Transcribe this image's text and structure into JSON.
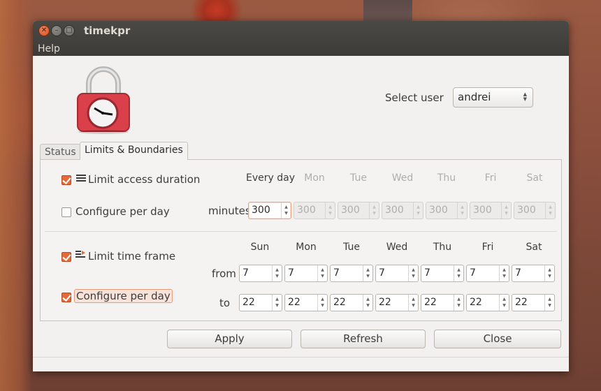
{
  "window": {
    "title": "timekpr"
  },
  "menu": {
    "help": "Help"
  },
  "user_select": {
    "label": "Select user",
    "value": "andrei"
  },
  "tabs": [
    {
      "label": "Status",
      "active": false
    },
    {
      "label": "Limits & Boundaries",
      "active": true
    }
  ],
  "duration": {
    "limit_label": "Limit access duration",
    "limit_checked": true,
    "per_day_label": "Configure per day",
    "per_day_checked": false,
    "minutes_label": "minutes",
    "headers": [
      "Every day",
      "Mon",
      "Tue",
      "Wed",
      "Thu",
      "Fri",
      "Sat"
    ],
    "values": [
      "300",
      "300",
      "300",
      "300",
      "300",
      "300",
      "300"
    ]
  },
  "timeframe": {
    "limit_label": "Limit time frame",
    "limit_checked": true,
    "per_day_label": "Configure per day",
    "per_day_checked": true,
    "from_label": "from",
    "to_label": "to",
    "days": [
      "Sun",
      "Mon",
      "Tue",
      "Wed",
      "Thu",
      "Fri",
      "Sat"
    ],
    "from": [
      "7",
      "7",
      "7",
      "7",
      "7",
      "7",
      "7"
    ],
    "to": [
      "22",
      "22",
      "22",
      "22",
      "22",
      "22",
      "22"
    ]
  },
  "buttons": {
    "apply": "Apply",
    "refresh": "Refresh",
    "close": "Close"
  },
  "colors": {
    "accent": "#e5693a",
    "titlebar": "#3c3b37",
    "window_bg": "#f2f1f0"
  }
}
